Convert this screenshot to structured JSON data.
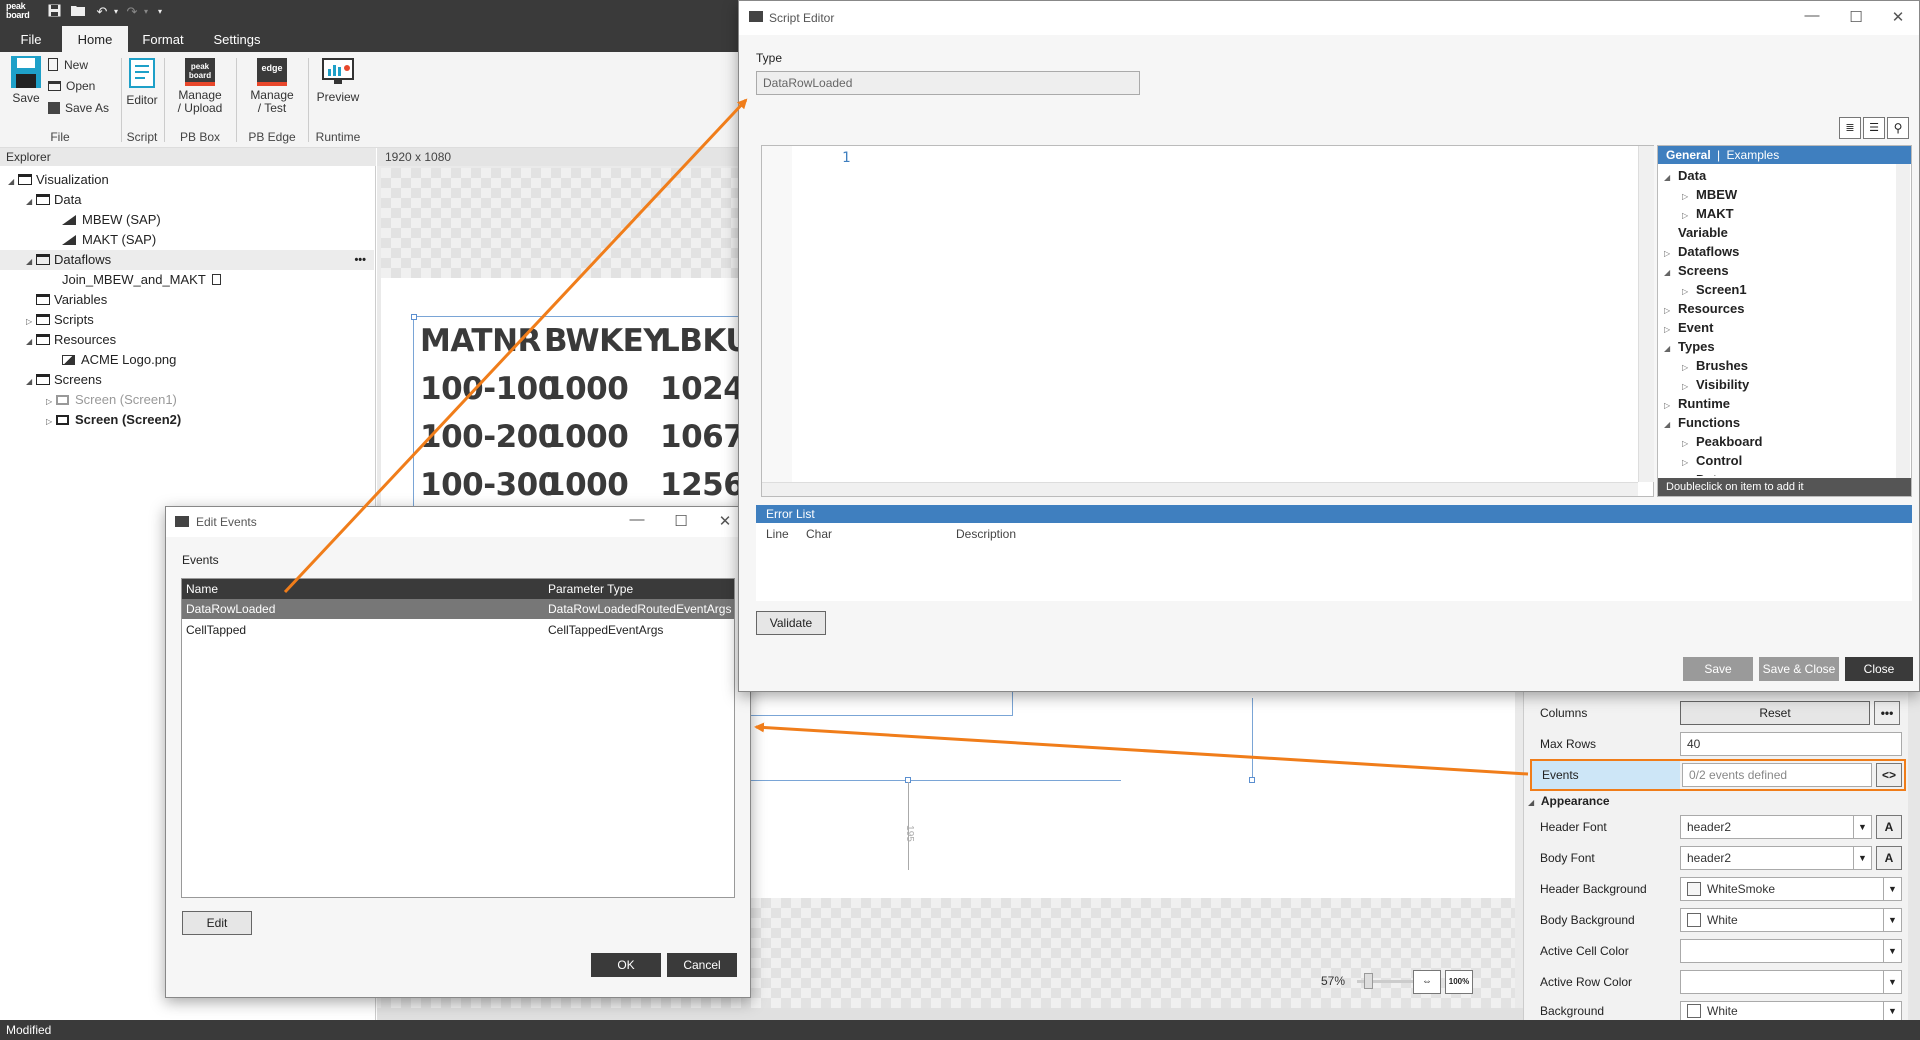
{
  "app": {
    "logo_text": "peak board",
    "menu_tabs": [
      "File",
      "Home",
      "Format",
      "Settings"
    ],
    "active_tab": "Home"
  },
  "ribbon": {
    "save": "Save",
    "new": "New",
    "open": "Open",
    "save_as": "Save As",
    "group_file": "File",
    "editor": "Editor",
    "group_script": "Script",
    "manage_upload_1": "Manage",
    "manage_upload_2": "/ Upload",
    "group_pbbox": "PB Box",
    "manage_test_1": "Manage",
    "manage_test_2": "/ Test",
    "group_pbedge": "PB Edge",
    "preview": "Preview",
    "group_runtime": "Runtime",
    "pb_box_icon_text": "peak board",
    "edge_icon_text": "edge"
  },
  "explorer": {
    "header": "Explorer",
    "visualization": "Visualization",
    "data": "Data",
    "mbew": "MBEW (SAP)",
    "makt": "MAKT (SAP)",
    "dataflows": "Dataflows",
    "dataflows_more": "•••",
    "join": "Join_MBEW_and_MAKT",
    "variables": "Variables",
    "scripts": "Scripts",
    "resources": "Resources",
    "acme": "ACME Logo.png",
    "screens": "Screens",
    "screen1": "Screen (Screen1)",
    "screen2": "Screen (Screen2)"
  },
  "canvas": {
    "resolution": "1920 x 1080",
    "table_headers": [
      "MATNR",
      "BWKEY",
      "LBKUI"
    ],
    "table_rows": [
      [
        "100-100",
        "1000",
        "1024"
      ],
      [
        "100-200",
        "1000",
        "1067"
      ],
      [
        "100-300",
        "1000",
        "1256"
      ]
    ],
    "dimension_label": "195",
    "zoom": "57%",
    "zoom_100": "100%"
  },
  "properties": {
    "columns_label": "Columns",
    "columns_reset": "Reset",
    "columns_more": "•••",
    "max_rows_label": "Max Rows",
    "max_rows_value": "40",
    "events_label": "Events",
    "events_value": "0/2 events defined",
    "events_btn": "<>",
    "appearance": "Appearance",
    "header_font_label": "Header Font",
    "header_font_value": "header2",
    "body_font_label": "Body Font",
    "body_font_value": "header2",
    "header_bg_label": "Header Background",
    "header_bg_value": "WhiteSmoke",
    "body_bg_label": "Body Background",
    "body_bg_value": "White",
    "active_cell_label": "Active Cell Color",
    "active_row_label": "Active Row Color",
    "background_label": "Background",
    "background_value": "White",
    "font_btn": "A"
  },
  "status": {
    "text": "Modified"
  },
  "edit_events": {
    "title": "Edit Events",
    "section": "Events",
    "col_name": "Name",
    "col_param": "Parameter Type",
    "rows": [
      {
        "name": "DataRowLoaded",
        "param": "DataRowLoadedRoutedEventArgs"
      },
      {
        "name": "CellTapped",
        "param": "CellTappedEventArgs"
      }
    ],
    "edit_btn": "Edit",
    "ok_btn": "OK",
    "cancel_btn": "Cancel"
  },
  "script_editor": {
    "title": "Script Editor",
    "type_label": "Type",
    "type_value": "DataRowLoaded",
    "line_number": "1",
    "tab_general": "General",
    "tab_sep": "|",
    "tab_examples": "Examples",
    "tree": [
      {
        "label": "Data",
        "level": 0,
        "tri": "open"
      },
      {
        "label": "MBEW",
        "level": 1,
        "tri": "closed"
      },
      {
        "label": "MAKT",
        "level": 1,
        "tri": "closed"
      },
      {
        "label": "Variable",
        "level": 0,
        "tri": "none"
      },
      {
        "label": "Dataflows",
        "level": 0,
        "tri": "closed"
      },
      {
        "label": "Screens",
        "level": 0,
        "tri": "open"
      },
      {
        "label": "Screen1",
        "level": 1,
        "tri": "closed"
      },
      {
        "label": "Resources",
        "level": 0,
        "tri": "closed"
      },
      {
        "label": "Event",
        "level": 0,
        "tri": "closed"
      },
      {
        "label": "Types",
        "level": 0,
        "tri": "open"
      },
      {
        "label": "Brushes",
        "level": 1,
        "tri": "closed"
      },
      {
        "label": "Visibility",
        "level": 1,
        "tri": "closed"
      },
      {
        "label": "Runtime",
        "level": 0,
        "tri": "closed"
      },
      {
        "label": "Functions",
        "level": 0,
        "tri": "open"
      },
      {
        "label": "Peakboard",
        "level": 1,
        "tri": "closed"
      },
      {
        "label": "Control",
        "level": 1,
        "tri": "closed"
      },
      {
        "label": "Date",
        "level": 1,
        "tri": "closed"
      }
    ],
    "tree_footer": "Doubleclick on item to add it",
    "error_list": "Error List",
    "col_line": "Line",
    "col_char": "Char",
    "col_desc": "Description",
    "validate_btn": "Validate",
    "save_btn": "Save",
    "save_close_btn": "Save & Close",
    "close_btn": "Close"
  },
  "colors": {
    "accent_orange": "#f07d1a",
    "header_blue": "#3f7fbf",
    "dark": "#3a3a3a",
    "selection_blue": "#cde6f7"
  }
}
